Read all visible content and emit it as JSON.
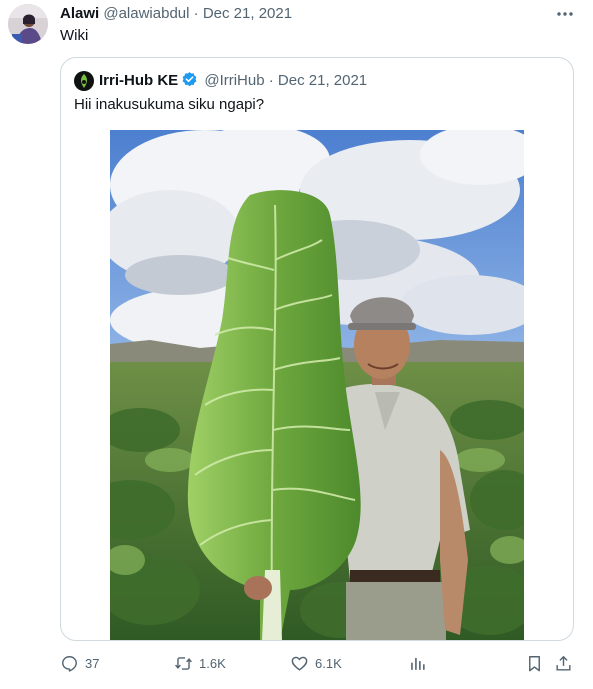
{
  "tweet": {
    "author_name": "Alawi",
    "handle": "@alawiabdul",
    "separator": "·",
    "date": "Dec 21, 2021",
    "text": "Wiki"
  },
  "quoted_tweet": {
    "author_name": "Irri-Hub KE",
    "handle": "@IrriHub",
    "separator": "·",
    "date": "Dec 21, 2021",
    "text": "Hii inakusukuma siku ngapi?"
  },
  "actions": {
    "replies": "37",
    "retweets": "1.6K",
    "likes": "6.1K"
  },
  "icons": {
    "more": "more-icon",
    "reply": "reply-icon",
    "retweet": "retweet-icon",
    "like": "heart-icon",
    "views": "analytics-icon",
    "bookmark": "bookmark-icon",
    "share": "share-icon",
    "verified": "verified-badge-icon"
  },
  "colors": {
    "text": "#0f1419",
    "muted": "#536471",
    "border": "#cfd9de",
    "verified_blue": "#1d9bf0"
  }
}
